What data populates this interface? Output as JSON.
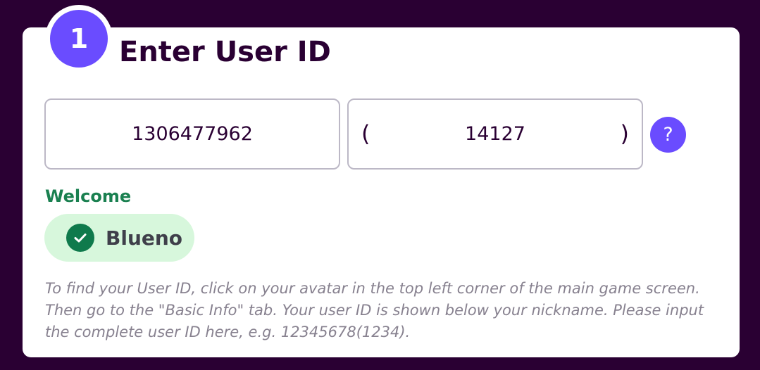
{
  "step": {
    "number": "1",
    "title": "Enter User ID"
  },
  "user_id_field": {
    "value": "1306477962"
  },
  "server_field": {
    "open_paren": "(",
    "value": "14127",
    "close_paren": ")"
  },
  "help": {
    "label": "?"
  },
  "welcome": {
    "label": "Welcome",
    "username": "Blueno"
  },
  "hint": {
    "text": "To find your User ID, click on your avatar in the top left corner of the main game screen. Then go to the \"Basic Info\" tab. Your user ID is shown below your nickname. Please input the complete user ID here, e.g. 12345678(1234)."
  },
  "colors": {
    "background": "#2a0033",
    "accent": "#6a4cff",
    "success": "#1a8050",
    "success_bg": "#d7f7dc"
  },
  "icons": {
    "help": "question-mark-icon",
    "verified": "check-circle-icon"
  }
}
